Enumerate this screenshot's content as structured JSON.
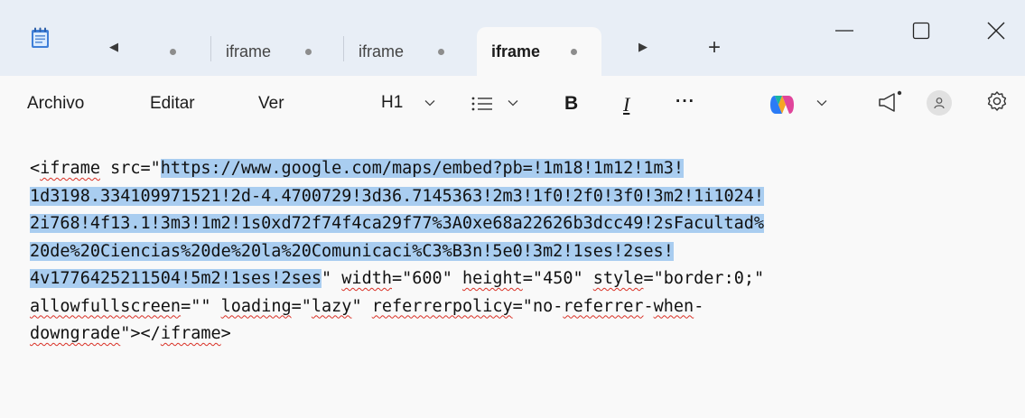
{
  "tabs": [
    {
      "label": "iframe",
      "modified": true,
      "active": false
    },
    {
      "label": "iframe",
      "modified": true,
      "active": false
    },
    {
      "label": "iframe",
      "modified": true,
      "active": true
    }
  ],
  "menu": {
    "file": "Archivo",
    "edit": "Editar",
    "view": "Ver"
  },
  "toolbar": {
    "heading": "H1",
    "bold": "B",
    "italic": "I",
    "more": "···"
  },
  "editor": {
    "lines": [
      [
        {
          "t": "<",
          "sel": false,
          "sq": false
        },
        {
          "t": "iframe",
          "sel": false,
          "sq": true
        },
        {
          "t": " src=\"",
          "sel": false,
          "sq": false
        },
        {
          "t": "https://www.google.com/maps/embed?pb=!1m18!1m12!1m3!",
          "sel": true,
          "sq": false
        }
      ],
      [
        {
          "t": "1d3198.334109971521!2d-4.4700729!3d36.7145363!2m3!1f0!2f0!3f0!3m2!1i1024!",
          "sel": true,
          "sq": false
        }
      ],
      [
        {
          "t": "2i768!4f13.1!3m3!1m2!1s0xd72f74f4ca29f77%3A0xe68a22626b3dcc49!2sFacultad%",
          "sel": true,
          "sq": false
        }
      ],
      [
        {
          "t": "20de%20Ciencias%20de%20la%20Comunicaci%C3%B3n!5e0!3m2!1ses!2ses!",
          "sel": true,
          "sq": false
        }
      ],
      [
        {
          "t": "4v1776425211504!5m2!1ses!2ses",
          "sel": true,
          "sq": false
        },
        {
          "t": "\" ",
          "sel": false,
          "sq": false
        },
        {
          "t": "width",
          "sel": false,
          "sq": true
        },
        {
          "t": "=\"600\" ",
          "sel": false,
          "sq": false
        },
        {
          "t": "height",
          "sel": false,
          "sq": true
        },
        {
          "t": "=\"450\" ",
          "sel": false,
          "sq": false
        },
        {
          "t": "style",
          "sel": false,
          "sq": true
        },
        {
          "t": "=\"border:0;\"",
          "sel": false,
          "sq": false
        }
      ],
      [
        {
          "t": "allowfullscreen",
          "sel": false,
          "sq": true
        },
        {
          "t": "=\"\" ",
          "sel": false,
          "sq": false
        },
        {
          "t": "loading",
          "sel": false,
          "sq": true
        },
        {
          "t": "=\"",
          "sel": false,
          "sq": false
        },
        {
          "t": "lazy",
          "sel": false,
          "sq": true
        },
        {
          "t": "\" ",
          "sel": false,
          "sq": false
        },
        {
          "t": "referrerpolicy",
          "sel": false,
          "sq": true
        },
        {
          "t": "=\"no-",
          "sel": false,
          "sq": false
        },
        {
          "t": "referrer",
          "sel": false,
          "sq": true
        },
        {
          "t": "-",
          "sel": false,
          "sq": false
        },
        {
          "t": "when",
          "sel": false,
          "sq": true
        },
        {
          "t": "-",
          "sel": false,
          "sq": false
        }
      ],
      [
        {
          "t": "downgrade",
          "sel": false,
          "sq": true
        },
        {
          "t": "\"></",
          "sel": false,
          "sq": false
        },
        {
          "t": "iframe",
          "sel": false,
          "sq": true
        },
        {
          "t": ">",
          "sel": false,
          "sq": false
        }
      ]
    ]
  },
  "colors": {
    "titlebar": "#e8eef6",
    "editor_bg": "#f9f9f9",
    "selection": "#a9cdf0",
    "spellcheck": "#d93025"
  }
}
